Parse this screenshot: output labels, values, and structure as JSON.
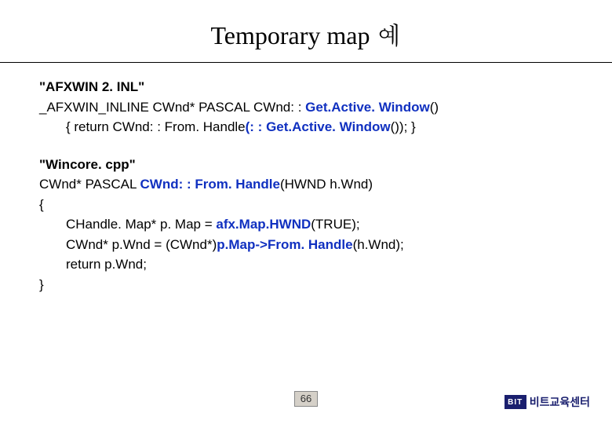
{
  "title": "Temporary map 예",
  "file1": "\"AFXWIN 2. INL\"",
  "line1": {
    "pre": "_AFXWIN_INLINE CWnd* PASCAL CWnd: : ",
    "blue1": "Get.Active. Window",
    "post1": "()"
  },
  "line2": {
    "pre": "{ return CWnd: : From. Handle",
    "blue1": "(: : Get.Active. Window",
    "post1": "()); }"
  },
  "file2": "\"Wincore. cpp\"",
  "line3": {
    "pre": "CWnd* PASCAL ",
    "boldblue": "CWnd: : From. Handle",
    "post": "(HWND h.Wnd)"
  },
  "line4": "{",
  "line5": {
    "pre": "CHandle. Map* p. Map = ",
    "boldblue": "afx.Map.HWND",
    "post": "(TRUE);"
  },
  "line6": {
    "pre": "CWnd* p.Wnd = (CWnd*)",
    "boldblue": "p.Map->From. Handle",
    "post": "(h.Wnd);"
  },
  "line7": "return p.Wnd;",
  "line8": "}",
  "pagenum": "66",
  "logo": {
    "box": "BIT",
    "text": "비트교육센터"
  }
}
